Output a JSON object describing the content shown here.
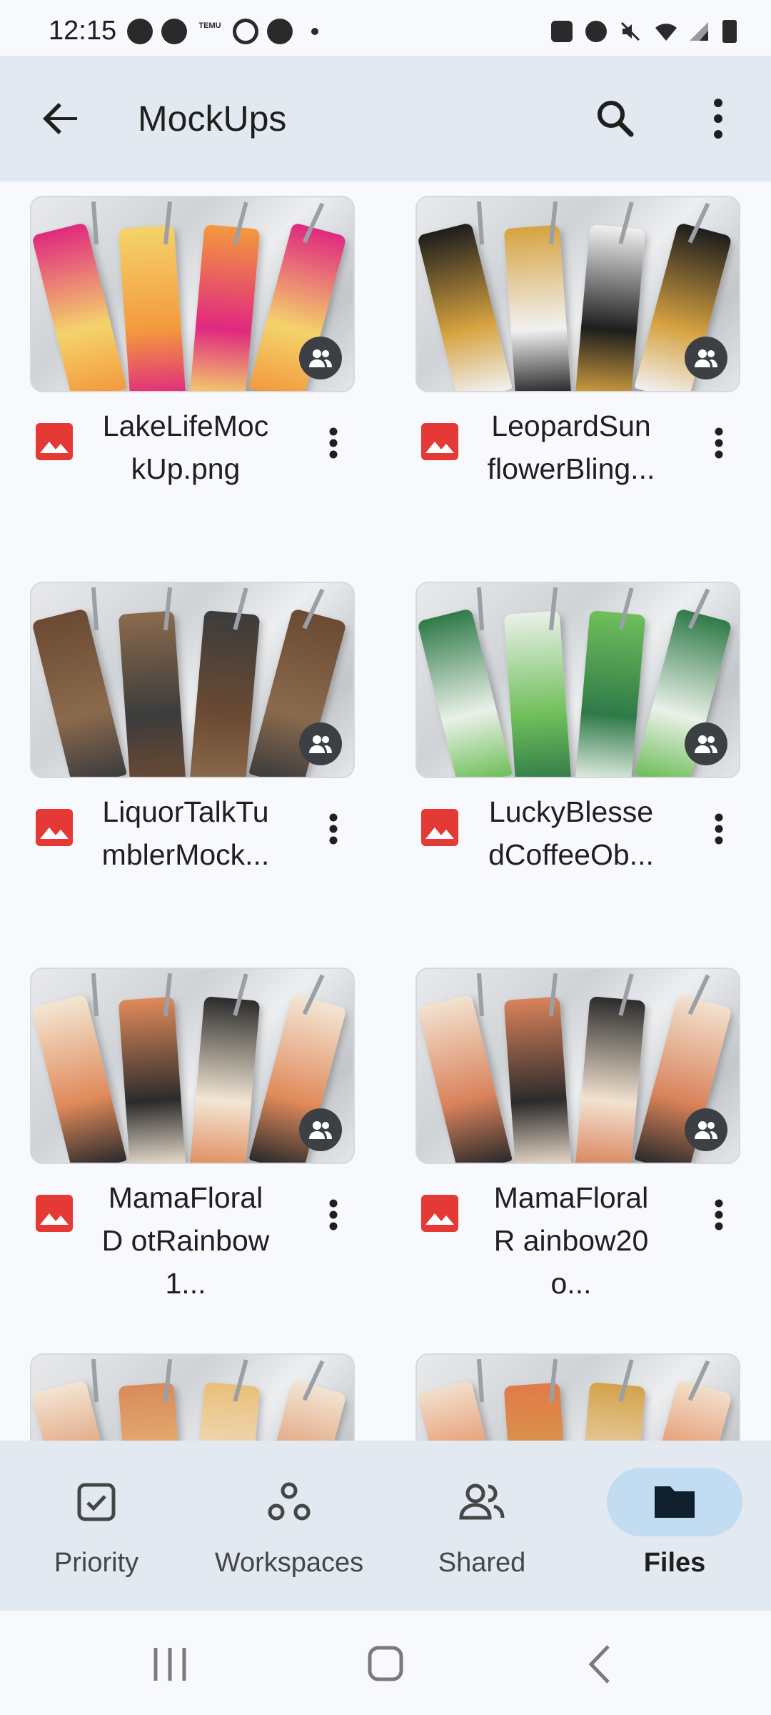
{
  "status_bar": {
    "time": "12:15",
    "notification_icons": [
      "messages-icon",
      "facebook-icon",
      "temu-icon",
      "circle-app-icon",
      "pinterest-icon",
      "more-dot-icon"
    ],
    "system_icons": [
      "battery-saver-icon",
      "alarm-icon",
      "mute-icon",
      "wifi-icon",
      "signal-icon",
      "battery-icon"
    ],
    "temu_text": "TEMU"
  },
  "app_bar": {
    "title": "MockUps",
    "back_icon": "arrow-back-icon",
    "search_icon": "search-icon",
    "more_icon": "more-vert-icon"
  },
  "files": [
    {
      "name": "LakeLifeMoc kUp.png",
      "type": "image",
      "shared": true,
      "palette": [
        "#e0287f",
        "#f4d36b",
        "#f39a3d"
      ]
    },
    {
      "name": "LeopardSun flowerBling...",
      "type": "image",
      "shared": true,
      "palette": [
        "#1d1d1d",
        "#d6a340",
        "#f1f1f1"
      ]
    },
    {
      "name": "LiquorTalkTu mblerMock...",
      "type": "image",
      "shared": true,
      "palette": [
        "#6b4a33",
        "#8b6a4d",
        "#3c3c3c"
      ]
    },
    {
      "name": "LuckyBlesse dCoffeeOb...",
      "type": "image",
      "shared": true,
      "palette": [
        "#2f7a48",
        "#e9f1e8",
        "#6fbf5a"
      ]
    },
    {
      "name": "MamaFloralD otRainbow1...",
      "type": "image",
      "shared": true,
      "palette": [
        "#f3e6d4",
        "#e08a5a",
        "#2b2b2b"
      ]
    },
    {
      "name": "MamaFloralR ainbow20o...",
      "type": "image",
      "shared": true,
      "palette": [
        "#f2e2d0",
        "#d9825a",
        "#2b2b2b"
      ]
    },
    {
      "name": "",
      "type": "image",
      "shared": false,
      "palette": [
        "#f3e4d2",
        "#d98a5c",
        "#e9c07a"
      ]
    },
    {
      "name": "",
      "type": "image",
      "shared": false,
      "palette": [
        "#f1e0cb",
        "#e27a4a",
        "#d3a34a"
      ]
    }
  ],
  "bottom_nav": [
    {
      "label": "Priority",
      "icon": "priority-check-icon",
      "active": false
    },
    {
      "label": "Workspaces",
      "icon": "workspaces-icon",
      "active": false
    },
    {
      "label": "Shared",
      "icon": "shared-people-icon",
      "active": false
    },
    {
      "label": "Files",
      "icon": "folder-icon",
      "active": true
    }
  ],
  "system_nav": [
    "recents-icon",
    "home-icon",
    "back-nav-icon"
  ],
  "colors": {
    "app_bar_bg": "#e3e9f1",
    "active_pill": "#c2dcf2",
    "image_file_red": "#e53935",
    "badge_bg": "#3c3f43"
  }
}
